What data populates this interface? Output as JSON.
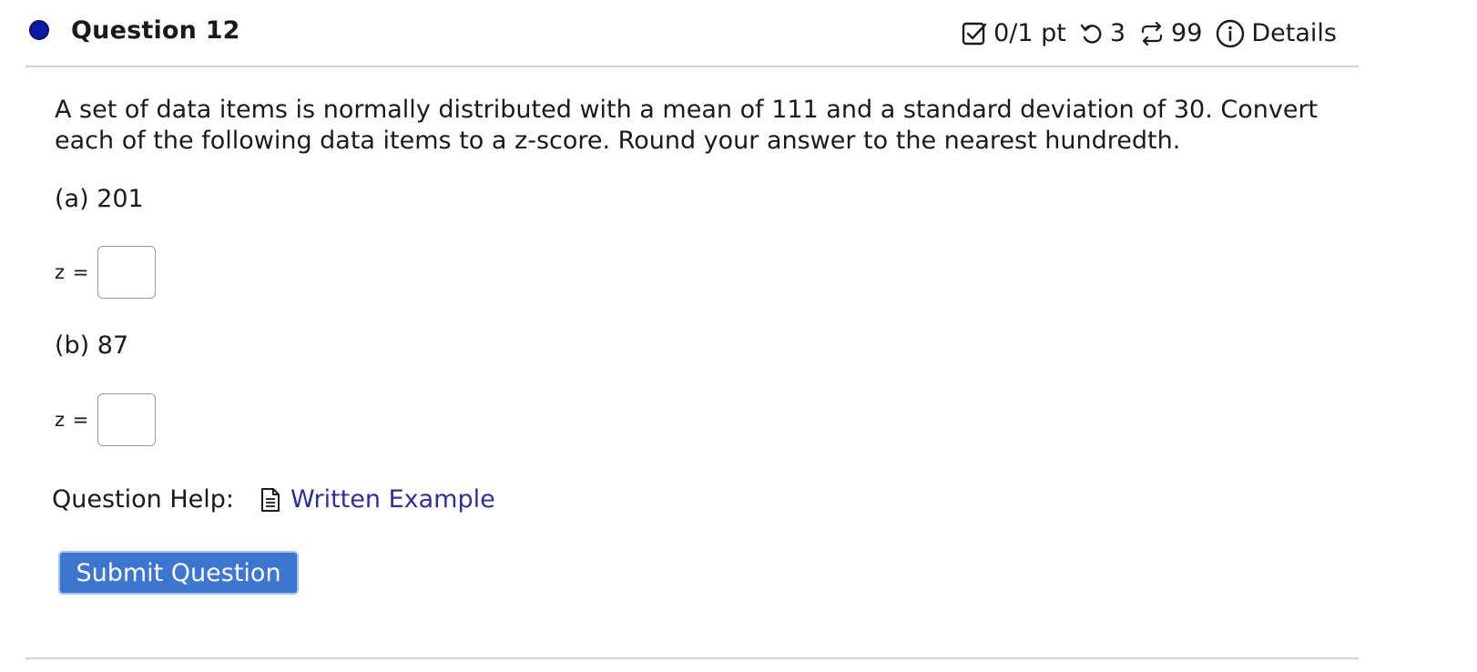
{
  "header": {
    "title": "Question 12",
    "score": "0/1 pt",
    "retries": "3",
    "submissions": "99",
    "details_label": "Details",
    "status_dot_color": "#0a1aa8"
  },
  "question": {
    "text": "A set of data items is normally distributed with a mean of 111 and a standard deviation of 30. Convert each of the following data items to a z-score. Round your answer to the nearest hundredth.",
    "parts": [
      {
        "label": "(a) 201",
        "answer_prefix": "z =",
        "answer_value": ""
      },
      {
        "label": "(b) 87",
        "answer_prefix": "z =",
        "answer_value": ""
      }
    ]
  },
  "help": {
    "label": "Question Help:",
    "link_text": "Written Example",
    "link_color": "#2e2e9e"
  },
  "submit": {
    "label": "Submit Question",
    "color": "#3d76d0"
  }
}
